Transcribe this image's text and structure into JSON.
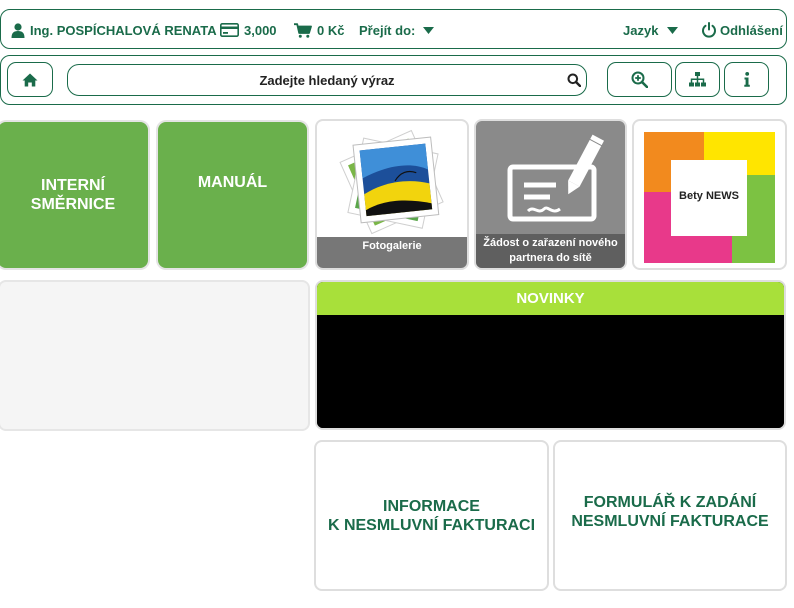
{
  "topbar": {
    "user_name": "Ing. POSPÍCHALOVÁ RENATA",
    "credit": "3,000",
    "cart": "0 Kč",
    "goto_label": "Přejít do:",
    "language_label": "Jazyk",
    "logout_label": "Odhlášení"
  },
  "search": {
    "placeholder": "Zadejte hledaný výraz"
  },
  "tiles": {
    "interni": "INTERNÍ SMĚRNICE",
    "manual": "MANUÁL",
    "fotogalerie": "Fotogalerie",
    "zadost": "Žádost o zařazení nového partnera do sítě",
    "bety_news": "Bety NEWS",
    "novinky": "NOVINKY",
    "informace_line1": "INFORMACE",
    "informace_line2": "K NESMLUVNÍ FAKTURACI",
    "formular_line1": "FORMULÁŘ K ZADÁNÍ",
    "formular_line2": "NESMLUVNÍ FAKTURACE"
  },
  "colors": {
    "brand_dark_green": "#1a6b4a",
    "tile_green": "#6ab04c",
    "news_green": "#a8e03a"
  }
}
